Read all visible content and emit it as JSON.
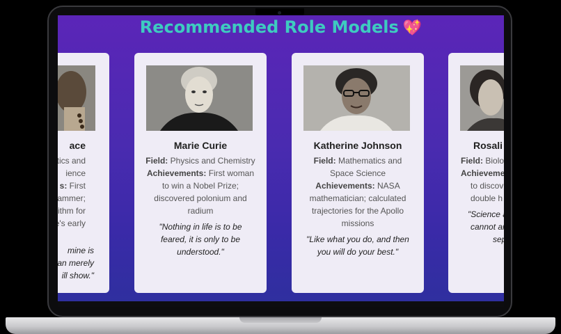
{
  "heading": {
    "title": "Recommended Role Models",
    "emoji": "💖"
  },
  "cards": [
    {
      "name": "ace",
      "field_label": "",
      "field_value": "tics and",
      "field_value2": "ience",
      "ach_label": "s:",
      "ach_value": "First",
      "ach_lines": [
        "rammer;",
        "rithm for",
        "e's early"
      ],
      "quote_lines": [
        "mine is",
        "an merely",
        "ill show.\""
      ]
    },
    {
      "name": "Marie Curie",
      "field_label": "Field:",
      "field_value": "Physics and Chemistry",
      "ach_label": "Achievements:",
      "ach_value": "First woman to win a Nobel Prize; discovered polonium and radium",
      "quote": "\"Nothing in life is to be feared, it is only to be understood.\""
    },
    {
      "name": "Katherine Johnson",
      "field_label": "Field:",
      "field_value": "Mathematics and Space Science",
      "ach_label": "Achievements:",
      "ach_value": "NASA mathematician; calculated trajectories for the Apollo missions",
      "quote": "\"Like what you do, and then you will do your best.\""
    },
    {
      "name": "Rosali",
      "field_label": "Field:",
      "field_value": "Biolo",
      "ach_label": "Achieveme",
      "ach_lines": [
        "to discov",
        "double h"
      ],
      "quote_lines": [
        "\"Science a",
        "cannot an",
        "sep"
      ]
    }
  ]
}
